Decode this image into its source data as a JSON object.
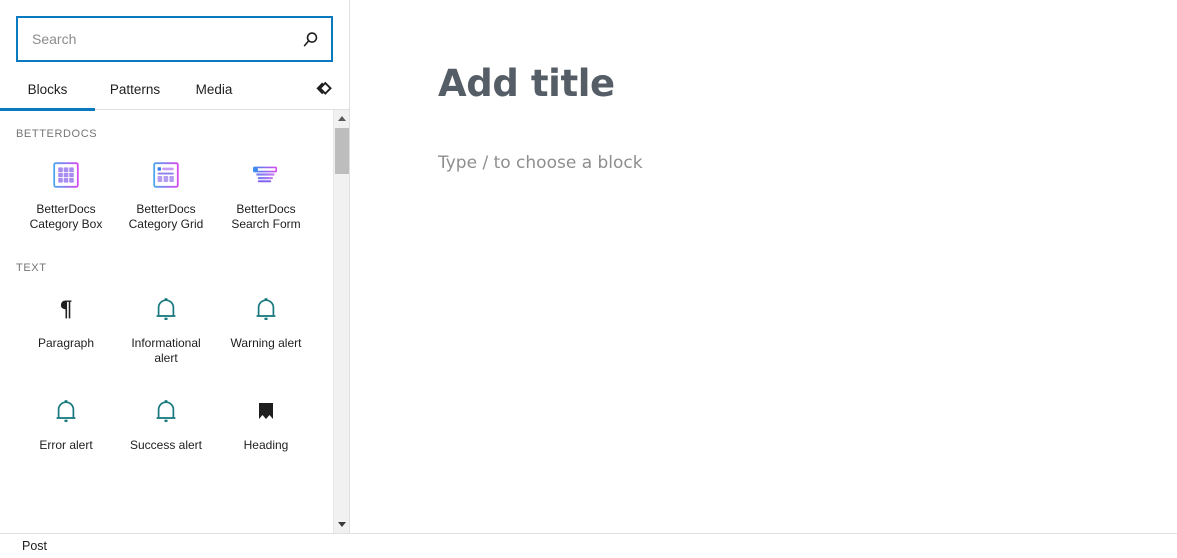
{
  "inserter": {
    "search": {
      "placeholder": "Search",
      "value": "",
      "icon": "search-icon"
    },
    "tabs": [
      {
        "label": "Blocks",
        "active": true
      },
      {
        "label": "Patterns",
        "active": false
      },
      {
        "label": "Media",
        "active": false
      }
    ],
    "collapse_icon": "chevron-double-left-diamond-icon",
    "sections": [
      {
        "title": "BETTERDOCS",
        "blocks": [
          {
            "label": "BetterDocs Category Box",
            "icon": "betterdocs-category-box-icon"
          },
          {
            "label": "BetterDocs Category Grid",
            "icon": "betterdocs-category-grid-icon"
          },
          {
            "label": "BetterDocs Search Form",
            "icon": "betterdocs-search-form-icon"
          }
        ]
      },
      {
        "title": "TEXT",
        "blocks": [
          {
            "label": "Paragraph",
            "icon": "pilcrow-icon"
          },
          {
            "label": "Informational alert",
            "icon": "bell-icon"
          },
          {
            "label": "Warning alert",
            "icon": "bell-icon"
          },
          {
            "label": "Error alert",
            "icon": "bell-icon"
          },
          {
            "label": "Success alert",
            "icon": "bell-icon"
          },
          {
            "label": "Heading",
            "icon": "bookmark-icon"
          }
        ]
      }
    ],
    "scrollbar": {
      "up_icon": "triangle-up-icon",
      "down_icon": "triangle-down-icon"
    }
  },
  "editor": {
    "title_placeholder": "Add title",
    "body_placeholder": "Type / to choose a block"
  },
  "statusbar": {
    "breadcrumb": [
      "Post"
    ]
  },
  "colors": {
    "accent": "#0a7ac0",
    "alert_icon": "#17787e",
    "section_label": "#757575",
    "title_text": "#555d66",
    "placeholder_text": "#8e8e8e"
  }
}
